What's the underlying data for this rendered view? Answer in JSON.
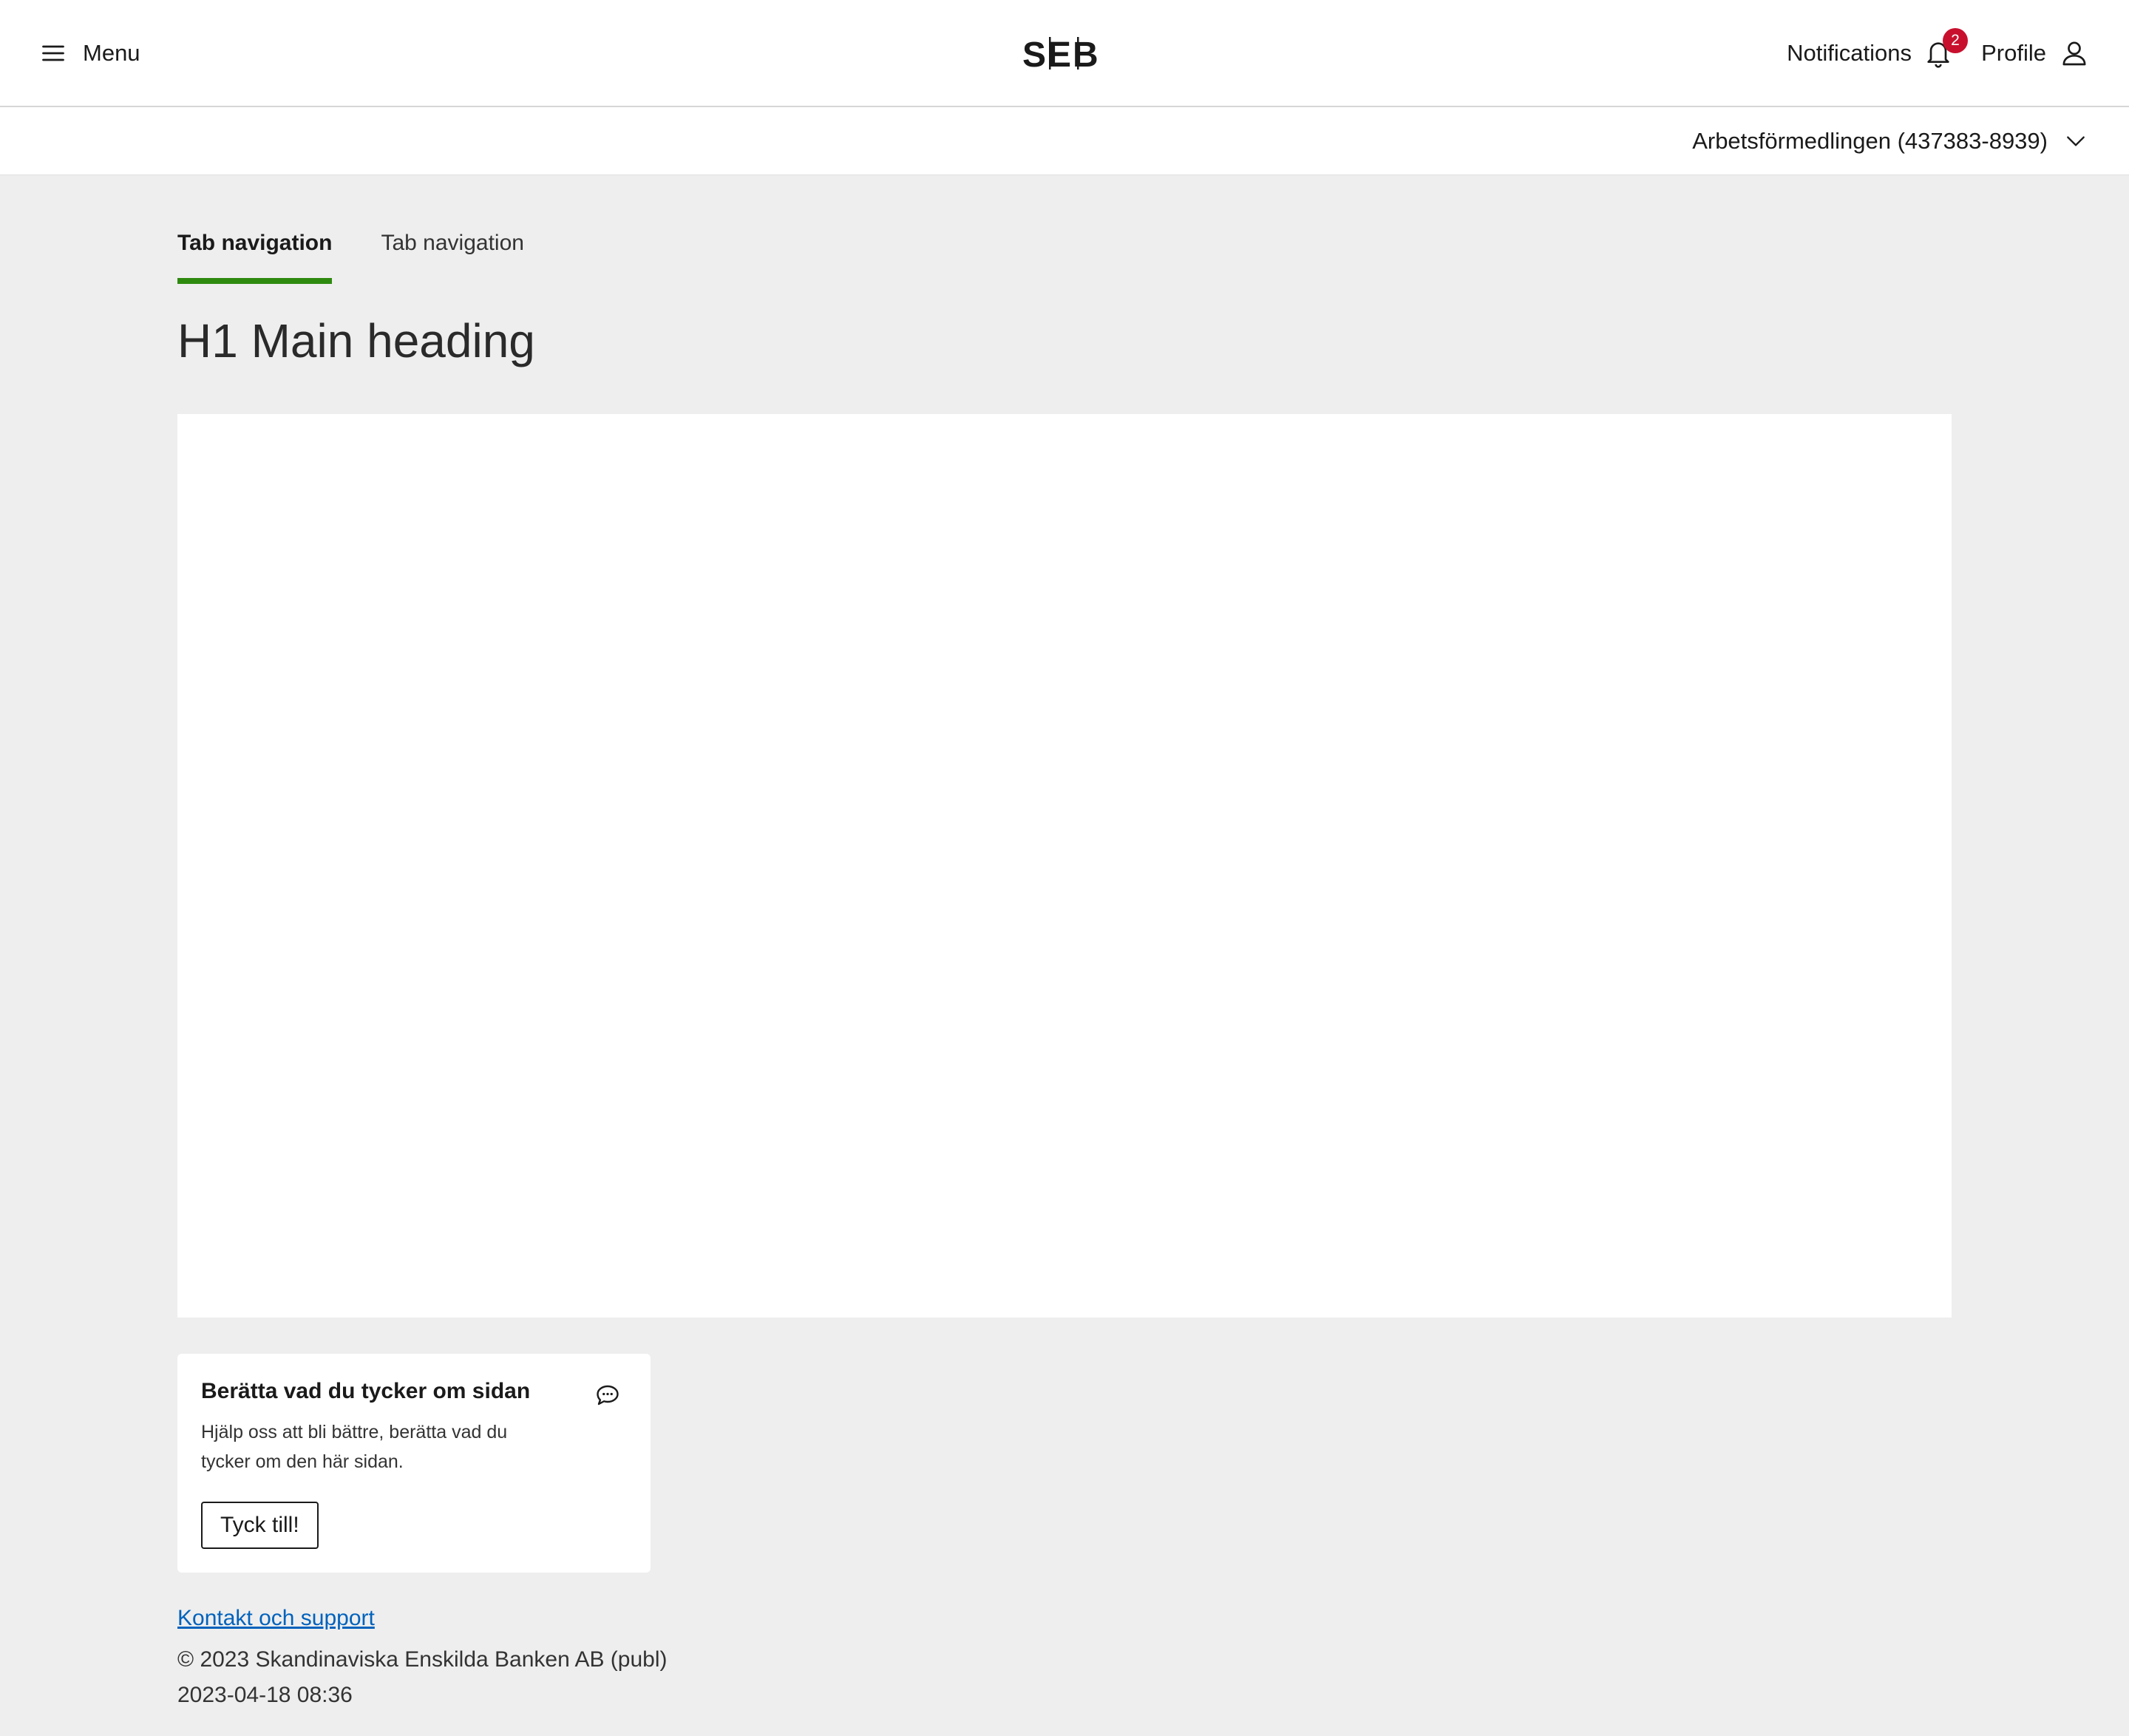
{
  "header": {
    "menu_label": "Menu",
    "logo_text": "SEB",
    "notifications_label": "Notifications",
    "notifications_count": "2",
    "profile_label": "Profile"
  },
  "account": {
    "selected": "Arbetsförmedlingen (437383-8939)"
  },
  "tabs": [
    {
      "label": "Tab navigation",
      "active": true
    },
    {
      "label": "Tab navigation",
      "active": false
    }
  ],
  "main": {
    "heading": "H1 Main heading"
  },
  "feedback": {
    "title": "Berätta vad du tycker om sidan",
    "description": "Hjälp oss att bli bättre, berätta vad du tycker om den här sidan.",
    "button_label": "Tyck till!"
  },
  "footer": {
    "link_label": "Kontakt och support",
    "copyright": "© 2023 Skandinaviska Enskilda Banken AB (publ)",
    "timestamp": "2023-04-18 08:36"
  },
  "colors": {
    "accent_green": "#2e8a0f",
    "badge_red": "#c8102e",
    "link_blue": "#0062bc",
    "page_background": "#eeeeee"
  }
}
